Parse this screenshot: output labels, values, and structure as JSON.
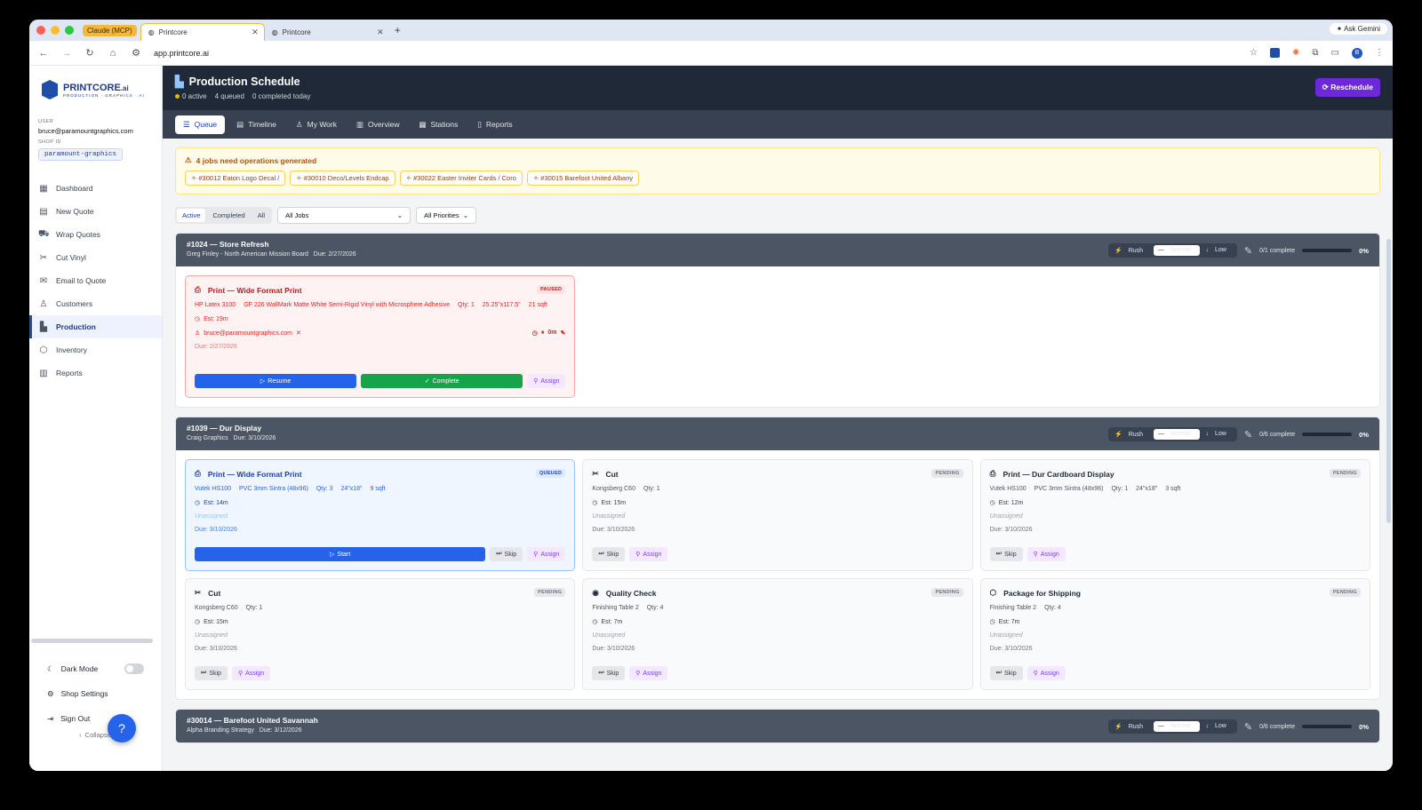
{
  "browser": {
    "tab_group": "Claude (MCP)",
    "tabs": [
      {
        "label": "Printcore"
      },
      {
        "label": "Printcore"
      }
    ],
    "url": "app.printcore.ai",
    "gemini": "Ask Gemini",
    "profile": "B"
  },
  "sidebar": {
    "logo": "PRINTCORE",
    "logo_suffix": ".ai",
    "logo_sub": "PRODUCTION · GRAPHICS · AI",
    "user_label": "USER",
    "user_email": "bruce@paramountgraphics.com",
    "shop_label": "SHOP ID",
    "shop_id": "paramount-graphics",
    "items": [
      {
        "label": "Dashboard",
        "icon": "grid-icon"
      },
      {
        "label": "New Quote",
        "icon": "document-icon"
      },
      {
        "label": "Wrap Quotes",
        "icon": "car-icon"
      },
      {
        "label": "Cut Vinyl",
        "icon": "scissors-icon"
      },
      {
        "label": "Email to Quote",
        "icon": "mail-icon"
      },
      {
        "label": "Customers",
        "icon": "users-icon"
      },
      {
        "label": "Production",
        "icon": "factory-icon"
      },
      {
        "label": "Inventory",
        "icon": "box-icon"
      },
      {
        "label": "Reports",
        "icon": "bar-chart-icon"
      }
    ],
    "dark_mode": "Dark Mode",
    "shop_settings": "Shop Settings",
    "sign_out": "Sign Out",
    "collapse": "Collapse"
  },
  "header": {
    "title": "Production Schedule",
    "active": "0 active",
    "queued": "4 queued",
    "completed": "0 completed today",
    "reschedule": "Reschedule"
  },
  "tabs": [
    {
      "label": "Queue",
      "icon": "☰"
    },
    {
      "label": "Timeline",
      "icon": "▤"
    },
    {
      "label": "My Work",
      "icon": "♙"
    },
    {
      "label": "Overview",
      "icon": "▥"
    },
    {
      "label": "Stations",
      "icon": "▦"
    },
    {
      "label": "Reports",
      "icon": "▯"
    }
  ],
  "alert": {
    "title": "4 jobs need operations generated",
    "chips": [
      "#30012 Eaton Logo Decal /",
      "#30010 Deco/Levels Endcap",
      "#30022 Easter Inviter Cards / Coro",
      "#30015 Barefoot United Albany"
    ]
  },
  "filters": {
    "status": [
      "Active",
      "Completed",
      "All"
    ],
    "jobs_select": "All Jobs",
    "priority_select": "All Priorities"
  },
  "priority_labels": [
    "Rush",
    "Normal",
    "Low"
  ],
  "jobs": [
    {
      "title": "#1024 — Store Refresh",
      "sub": "Greg Finley - North American Mission Board",
      "due": "Due: 2/27/2026",
      "progress": "0/1 complete",
      "pct": "0%",
      "ops": [
        {
          "state": "paused",
          "badge": "PAUSED",
          "title": "Print — Wide Format Print",
          "specs": [
            "HP Latex 3100",
            "GF 226 WallMark Matte White Semi-Rigid Vinyl with Microsphere Adhesive",
            "Qty: 1",
            "25.25\"x117.5\"",
            "21 sqft"
          ],
          "est": "Est: 19m",
          "assignee": "bruce@paramountgraphics.com",
          "due": "Due: 2/27/2026",
          "timer": "0m",
          "actions": [
            "Resume",
            "Complete",
            "Assign"
          ]
        }
      ]
    },
    {
      "title": "#1039 — Dur Display",
      "sub": "Craig Graphics",
      "due": "Due: 3/10/2026",
      "progress": "0/6 complete",
      "pct": "0%",
      "ops": [
        {
          "state": "queued",
          "badge": "QUEUED",
          "title": "Print — Wide Format Print",
          "specs": [
            "Vutek HS100",
            "PVC 3mm Sintra (48x96)",
            "Qty: 3",
            "24\"x18\"",
            "9 sqft"
          ],
          "est": "Est: 14m",
          "assignee": "Unassigned",
          "due": "Due: 3/10/2026",
          "actions": [
            "Start",
            "Skip",
            "Assign"
          ]
        },
        {
          "state": "pending",
          "badge": "PENDING",
          "title": "Cut",
          "specs": [
            "Kongsberg C60",
            "Qty: 1"
          ],
          "est": "Est: 15m",
          "assignee": "Unassigned",
          "due": "Due: 3/10/2026",
          "actions": [
            "Skip",
            "Assign"
          ]
        },
        {
          "state": "pending",
          "badge": "PENDING",
          "title": "Print — Dur Cardboard Display",
          "specs": [
            "Vutek HS100",
            "PVC 3mm Sintra (48x96)",
            "Qty: 1",
            "24\"x18\"",
            "3 sqft"
          ],
          "est": "Est: 12m",
          "assignee": "Unassigned",
          "due": "Due: 3/10/2026",
          "actions": [
            "Skip",
            "Assign"
          ]
        },
        {
          "state": "pending",
          "badge": "PENDING",
          "title": "Cut",
          "specs": [
            "Kongsberg C60",
            "Qty: 1"
          ],
          "est": "Est: 15m",
          "assignee": "Unassigned",
          "due": "Due: 3/10/2026",
          "actions": [
            "Skip",
            "Assign"
          ]
        },
        {
          "state": "pending",
          "badge": "PENDING",
          "title": "Quality Check",
          "specs": [
            "Finishing Table 2",
            "Qty: 4"
          ],
          "est": "Est: 7m",
          "assignee": "Unassigned",
          "due": "Due: 3/10/2026",
          "actions": [
            "Skip",
            "Assign"
          ]
        },
        {
          "state": "pending",
          "badge": "PENDING",
          "title": "Package for Shipping",
          "specs": [
            "Finishing Table 2",
            "Qty: 4"
          ],
          "est": "Est: 7m",
          "assignee": "Unassigned",
          "due": "Due: 3/10/2026",
          "actions": [
            "Skip",
            "Assign"
          ]
        }
      ]
    },
    {
      "title": "#30014 — Barefoot United Savannah",
      "sub": "Alpha Branding Strategy",
      "due": "Due: 3/12/2026",
      "progress": "0/6 complete",
      "pct": "0%",
      "ops": []
    }
  ]
}
